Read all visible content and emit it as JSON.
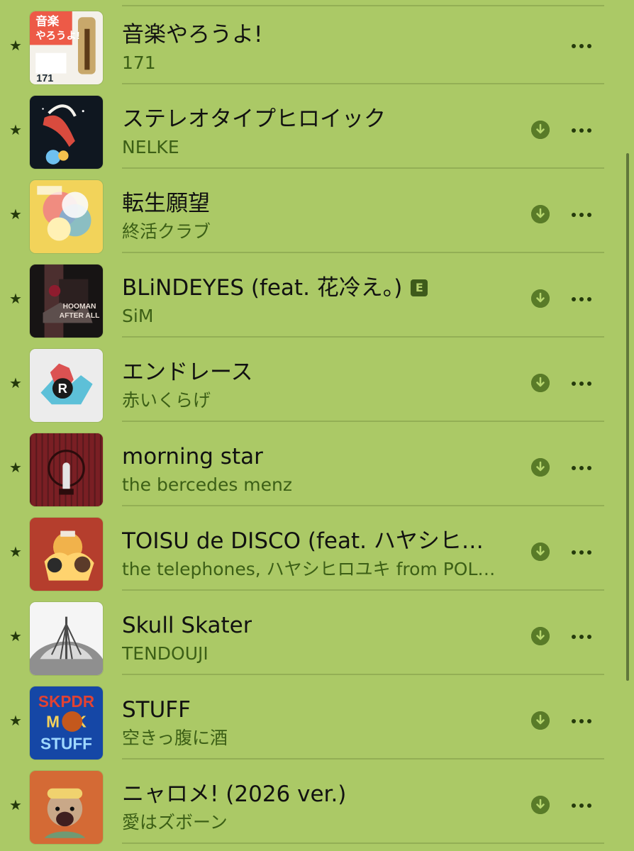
{
  "tracks": [
    {
      "title": "音楽やろうよ!",
      "artist": "171",
      "explicit": false,
      "downloadable": false,
      "artwork_label": "音楽\nやろうよ!\n171",
      "artwork_palette": [
        "#f4f1ea",
        "#ed5a47",
        "#1f2c36",
        "#c8a86b"
      ]
    },
    {
      "title": "ステレオタイプヒロイック",
      "artist": "NELKE",
      "explicit": false,
      "downloadable": true,
      "artwork_label": "",
      "artwork_palette": [
        "#0f1720",
        "#d94b3e",
        "#f4f2ec",
        "#7f8891"
      ]
    },
    {
      "title": "転生願望",
      "artist": "終活クラブ",
      "explicit": false,
      "downloadable": true,
      "artwork_label": "",
      "artwork_palette": [
        "#f2d35a",
        "#ef7b8a",
        "#68b7e6",
        "#fbfbfb"
      ]
    },
    {
      "title": "BLiNDEYES (feat. 花冷え。)",
      "artist": "SiM",
      "explicit": true,
      "downloadable": true,
      "artwork_label": "HOOMAN\nAFTER ALL",
      "artwork_palette": [
        "#171414",
        "#8e1c2e",
        "#e7dcd4",
        "#4c2f2f"
      ]
    },
    {
      "title": "エンドレース",
      "artist": "赤いくらげ",
      "explicit": false,
      "downloadable": true,
      "artwork_label": "",
      "artwork_palette": [
        "#ececec",
        "#db5252",
        "#5dc0d8",
        "#1a1a1a"
      ]
    },
    {
      "title": "morning star",
      "artist": "the bercedes menz",
      "explicit": false,
      "downloadable": true,
      "artwork_label": "",
      "artwork_palette": [
        "#7a1f24",
        "#2f1112",
        "#b87e7f",
        "#e5e5e5"
      ]
    },
    {
      "title": "TOISU de DISCO (feat. ハヤシヒ…",
      "artist": "the telephones, ハヤシヒロユキ from POL…",
      "explicit": false,
      "downloadable": true,
      "artwork_label": "",
      "artwork_palette": [
        "#b53e2d",
        "#f1b24b",
        "#2b2b2b",
        "#f0e8dc"
      ]
    },
    {
      "title": "Skull Skater",
      "artist": "TENDOUJI",
      "explicit": false,
      "downloadable": true,
      "artwork_label": "",
      "artwork_palette": [
        "#d9d9d9",
        "#8f8f8f",
        "#4a4a4a",
        "#f5f5f5"
      ]
    },
    {
      "title": "STUFF",
      "artist": "空きっ腹に酒",
      "explicit": false,
      "downloadable": true,
      "artwork_label": "SKPDR\nM SK\nSTUFF",
      "artwork_palette": [
        "#1547a6",
        "#e24232",
        "#f5d25b",
        "#9fd8ff"
      ]
    },
    {
      "title": "ニャロメ! (2026 ver.)",
      "artist": "愛はズボーン",
      "explicit": false,
      "downloadable": true,
      "artwork_label": "",
      "artwork_palette": [
        "#d46a35",
        "#f0d26e",
        "#6f9a73",
        "#272727"
      ]
    }
  ],
  "icons": {
    "star": "star-icon",
    "download": "download-icon",
    "more": "more-icon",
    "explicit": "explicit-badge"
  },
  "badge_text": {
    "explicit": "E"
  },
  "colors": {
    "background": "#abc966",
    "divider": "#93af55",
    "title": "#111111",
    "artist": "#3c5f16",
    "icon_dark": "#253a0c",
    "download": "#597b28",
    "explicit_badge": "#3e5a1b"
  }
}
